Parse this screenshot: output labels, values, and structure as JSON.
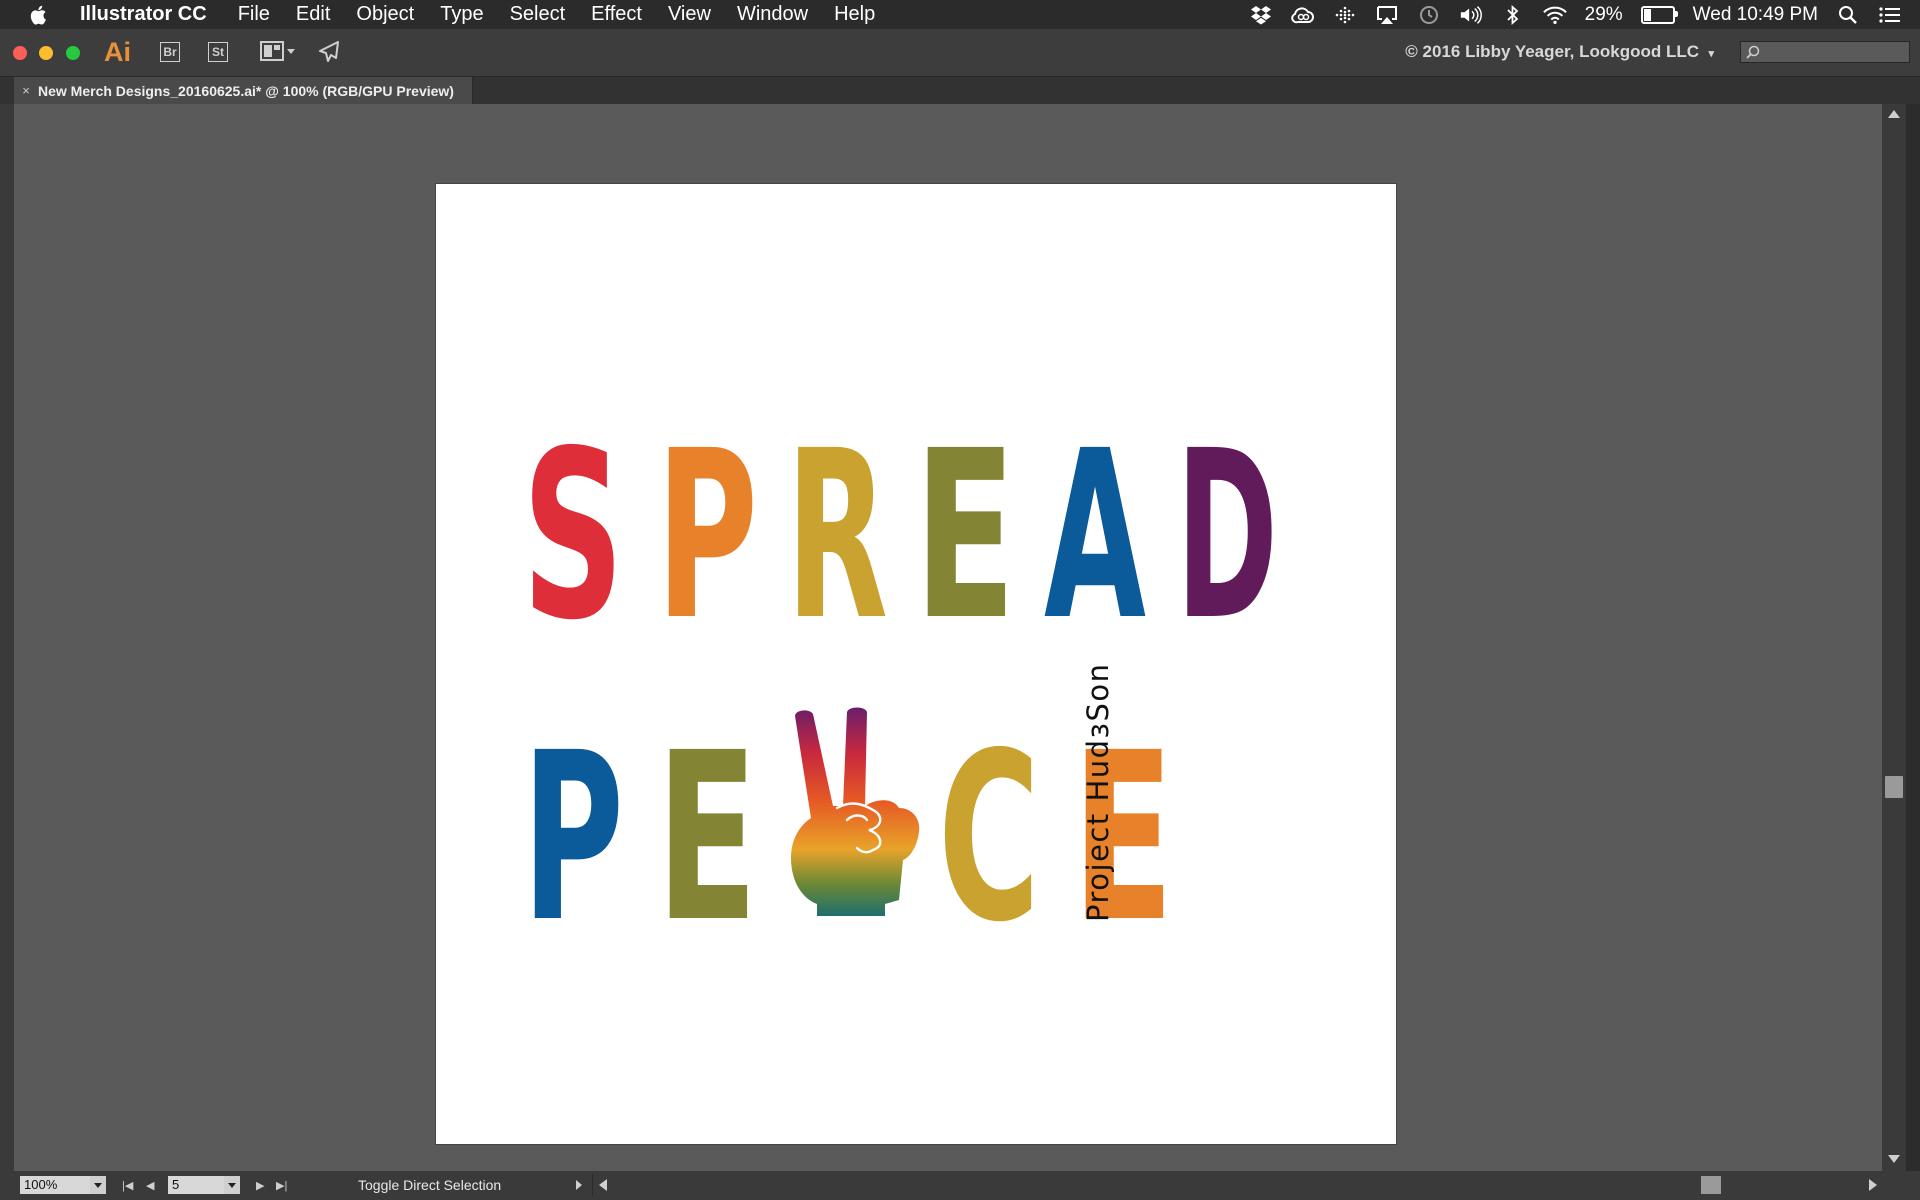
{
  "menubar": {
    "app_name": "Illustrator CC",
    "items": [
      "File",
      "Edit",
      "Object",
      "Type",
      "Select",
      "Effect",
      "View",
      "Window",
      "Help"
    ],
    "battery_percent": "29%",
    "battery_level": 0.29,
    "clock": "Wed 10:49 PM"
  },
  "appbar": {
    "logo": "Ai",
    "bridge_label": "Br",
    "stock_label": "St",
    "workspace_title": "© 2016 Libby Yeager, Lookgood LLC",
    "search_placeholder": ""
  },
  "document": {
    "tab_close": "×",
    "tab_title": "New Merch Designs_20160625.ai* @ 100% (RGB/GPU Preview)"
  },
  "artwork": {
    "line1": [
      {
        "char": "S",
        "color": "#dd2e3a"
      },
      {
        "char": "P",
        "color": "#e8822a"
      },
      {
        "char": "R",
        "color": "#c9a230"
      },
      {
        "char": "E",
        "color": "#838535"
      },
      {
        "char": "A",
        "color": "#0b5a9a"
      },
      {
        "char": "D",
        "color": "#611b5a"
      }
    ],
    "line2": [
      {
        "char": "P",
        "color": "#0b5a9a"
      },
      {
        "char": "E",
        "color": "#838535"
      },
      {
        "char": "C",
        "color": "#c9a230"
      },
      {
        "char": "E",
        "color": "#e8822a"
      }
    ],
    "hand_label": "peace-hand-graphic",
    "side_text": "Project HudɜSon"
  },
  "statusbar": {
    "zoom": "100%",
    "page": "5",
    "tool_hint": "Toggle Direct Selection"
  }
}
